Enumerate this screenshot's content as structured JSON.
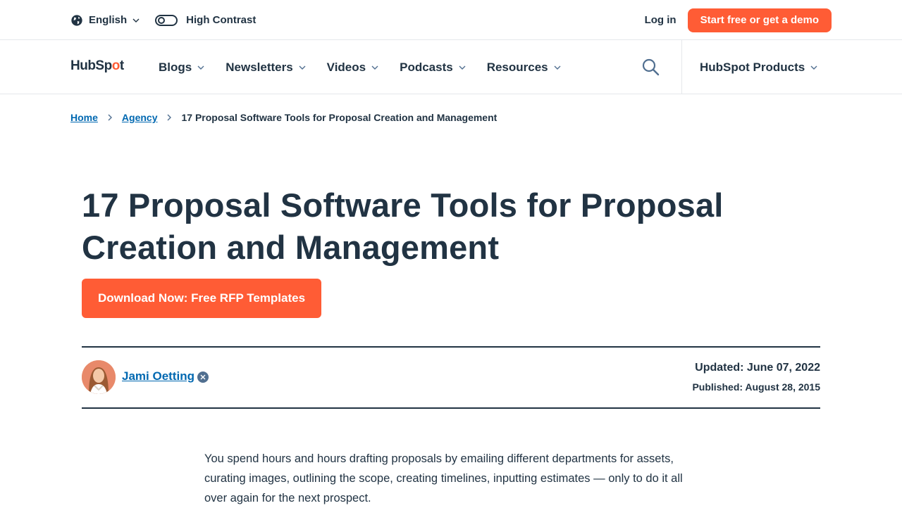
{
  "utility": {
    "language": "English",
    "high_contrast": "High Contrast",
    "login": "Log in",
    "cta": "Start free or get a demo"
  },
  "nav": {
    "logo_a": "HubSp",
    "logo_b": "o",
    "logo_c": "t",
    "items": [
      {
        "label": "Blogs"
      },
      {
        "label": "Newsletters"
      },
      {
        "label": "Videos"
      },
      {
        "label": "Podcasts"
      },
      {
        "label": "Resources"
      }
    ],
    "products": "HubSpot Products"
  },
  "breadcrumb": {
    "home": "Home",
    "agency": "Agency",
    "current": "17 Proposal Software Tools for Proposal Creation and Management"
  },
  "article": {
    "title": "17 Proposal Software Tools for Proposal Creation and Management",
    "cta": "Download Now: Free RFP Templates",
    "author": "Jami Oetting",
    "updated": "Updated: June 07, 2022",
    "published": "Published: August 28, 2015",
    "intro": "You spend hours and hours drafting proposals by emailing different departments for assets, curating images, outlining the scope, creating timelines, inputting estimates — only to do it all over again for the next prospect."
  },
  "colors": {
    "brand": "#ff5c35",
    "text": "#213343",
    "link": "#0068b1"
  }
}
